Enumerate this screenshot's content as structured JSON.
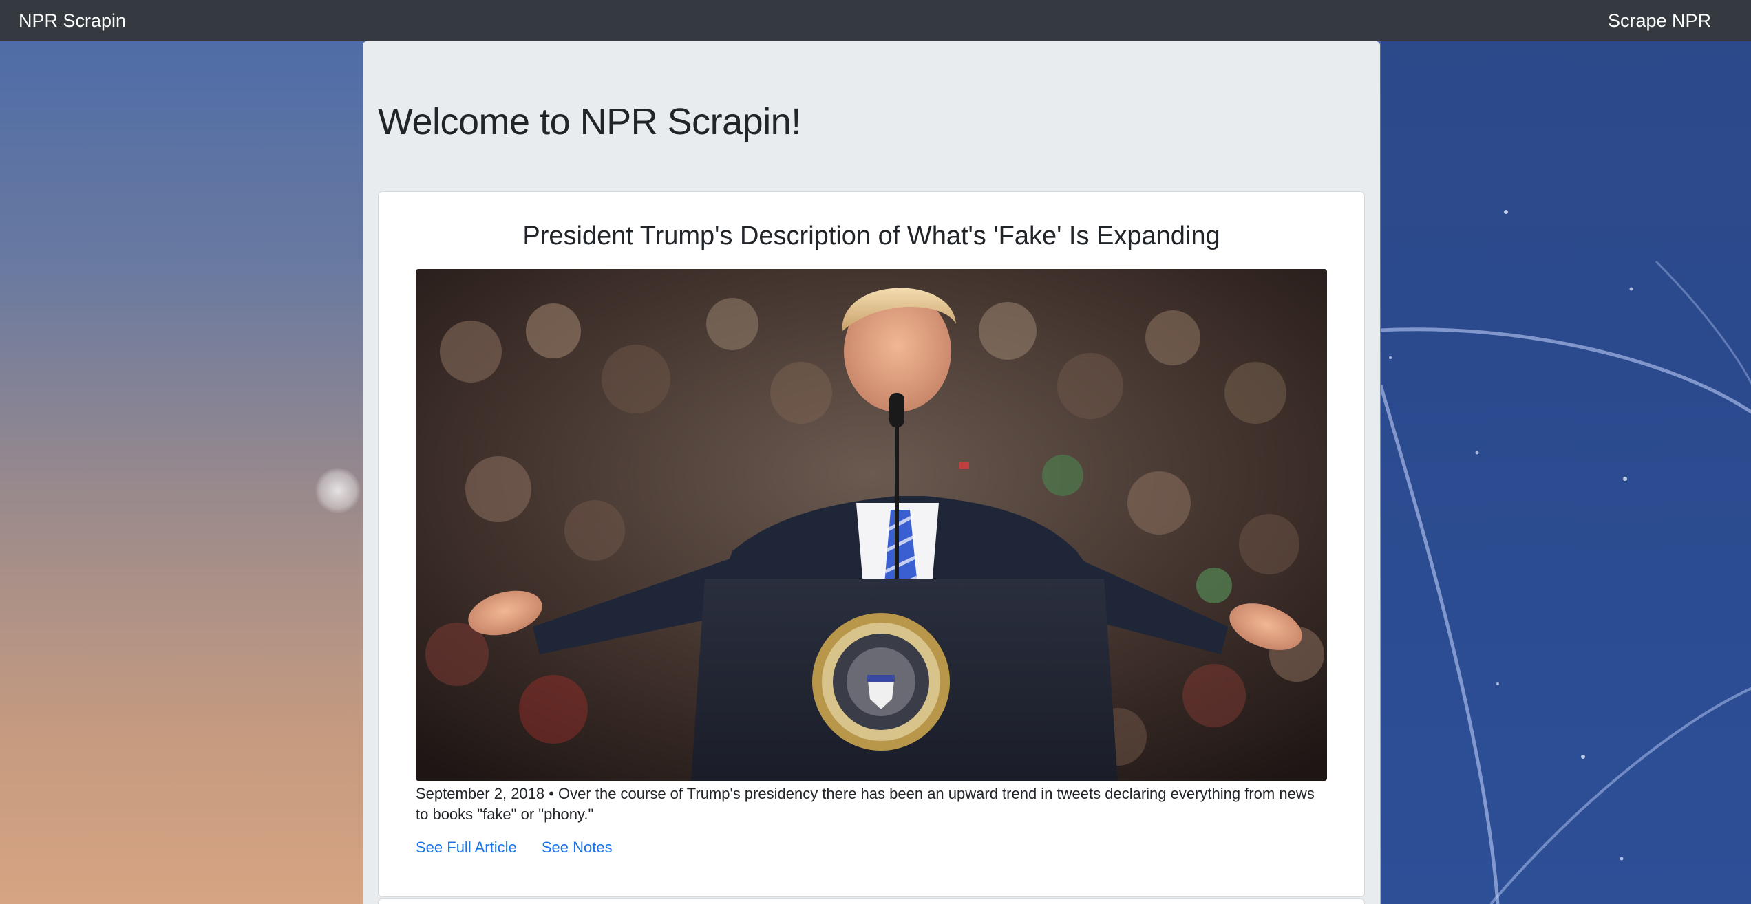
{
  "navbar": {
    "brand": "NPR Scrapin",
    "scrape_link": "Scrape NPR"
  },
  "jumbotron": {
    "heading": "Welcome to NPR Scrapin!"
  },
  "articles": [
    {
      "title": "President Trump's Description of What's 'Fake' Is Expanding",
      "image_alt": "photo-trump-at-podium",
      "summary": "September 2, 2018 • Over the course of Trump's presidency there has been an upward trend in tweets declaring everything from news to books \"fake\" or \"phony.\"",
      "full_article_label": "See Full Article",
      "notes_label": "See Notes"
    }
  ],
  "colors": {
    "navbar": "#343a40",
    "jumbotron": "#e9ecef",
    "link": "#1a73e8",
    "text": "#212529"
  }
}
